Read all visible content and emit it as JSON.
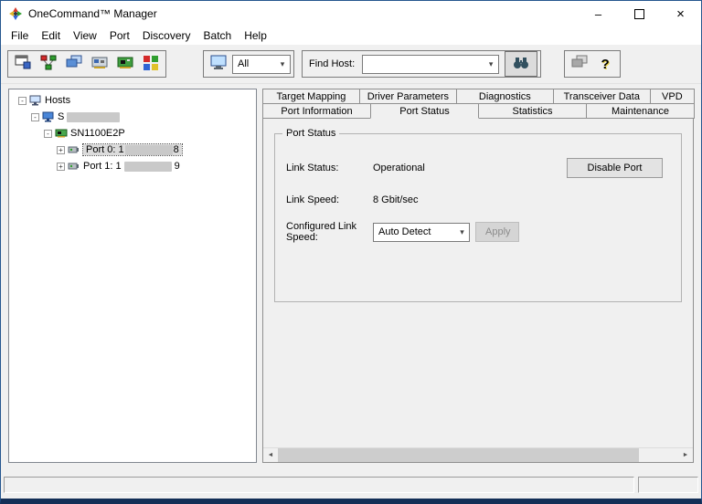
{
  "window": {
    "title": "OneCommand™ Manager"
  },
  "icons": {
    "minimize": "–",
    "close": "×",
    "help": "?",
    "dropdown": "▾",
    "left_arrow": "◄",
    "right_arrow": "►",
    "plus": "+",
    "minus": "-"
  },
  "menu": {
    "items": [
      "File",
      "Edit",
      "View",
      "Port",
      "Discovery",
      "Batch",
      "Help"
    ]
  },
  "toolbar": {
    "filter_value": "All",
    "find_host_label": "Find Host:",
    "find_host_value": ""
  },
  "tree": {
    "root_label": "Hosts",
    "host_prefix": "S",
    "adapter_label": "SN1100E2P",
    "ports": [
      {
        "prefix": "Port 0: 1",
        "suffix": "8"
      },
      {
        "prefix": "Port 1: 1",
        "suffix": "9"
      }
    ]
  },
  "tabs": {
    "row1": [
      "Target Mapping",
      "Driver Parameters",
      "Diagnostics",
      "Transceiver Data",
      "VPD"
    ],
    "row2": [
      "Port Information",
      "Port Status",
      "Statistics",
      "Maintenance"
    ],
    "active": "Port Status"
  },
  "port_status": {
    "group_title": "Port Status",
    "link_status_label": "Link Status:",
    "link_status_value": "Operational",
    "disable_button": "Disable Port",
    "link_speed_label": "Link Speed:",
    "link_speed_value": "8 Gbit/sec",
    "configured_label": "Configured Link Speed:",
    "configured_value": "Auto Detect",
    "apply_button": "Apply"
  }
}
